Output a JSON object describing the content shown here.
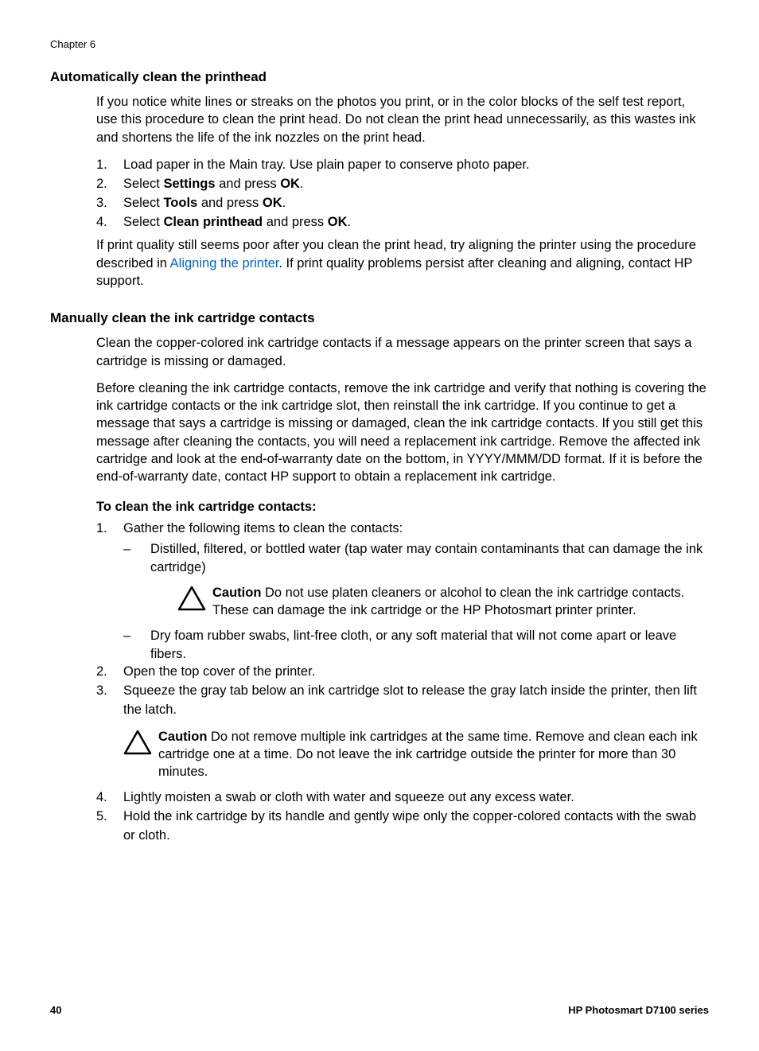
{
  "chapter_label": "Chapter 6",
  "section1": {
    "heading": "Automatically clean the printhead",
    "intro": "If you notice white lines or streaks on the photos you print, or in the color blocks of the self test report, use this procedure to clean the print head. Do not clean the print head unnecessarily, as this wastes ink and shortens the life of the ink nozzles on the print head.",
    "steps": [
      {
        "num": "1.",
        "text_pre": "Load paper in the Main tray. Use plain paper to conserve photo paper."
      },
      {
        "num": "2.",
        "text_pre": "Select ",
        "bold1": "Settings",
        "text_mid": " and press ",
        "bold2": "OK",
        "text_post": "."
      },
      {
        "num": "3.",
        "text_pre": "Select ",
        "bold1": "Tools",
        "text_mid": " and press ",
        "bold2": "OK",
        "text_post": "."
      },
      {
        "num": "4.",
        "text_pre": "Select ",
        "bold1": "Clean printhead",
        "text_mid": " and press ",
        "bold2": "OK",
        "text_post": "."
      }
    ],
    "outro_pre": "If print quality still seems poor after you clean the print head, try aligning the printer using the procedure described in ",
    "outro_link": "Aligning the printer",
    "outro_post": ". If print quality problems persist after cleaning and aligning, contact HP support."
  },
  "section2": {
    "heading": "Manually clean the ink cartridge contacts",
    "para1": "Clean the copper-colored ink cartridge contacts if a message appears on the printer screen that says a cartridge is missing or damaged.",
    "para2": "Before cleaning the ink cartridge contacts, remove the ink cartridge and verify that nothing is covering the ink cartridge contacts or the ink cartridge slot, then reinstall the ink cartridge. If you continue to get a message that says a cartridge is missing or damaged, clean the ink cartridge contacts. If you still get this message after cleaning the contacts, you will need a replacement ink cartridge. Remove the affected ink cartridge and look at the end-of-warranty date on the bottom, in YYYY/MMM/DD format. If it is before the end-of-warranty date, contact HP support to obtain a replacement ink cartridge.",
    "subheading": "To clean the ink cartridge contacts:",
    "step1": {
      "num": "1.",
      "text": "Gather the following items to clean the contacts:"
    },
    "step1_sub1": "Distilled, filtered, or bottled water (tap water may contain contaminants that can damage the ink cartridge)",
    "caution1_label": "Caution",
    "caution1_text": "   Do not use platen cleaners or alcohol to clean the ink cartridge contacts. These can damage the ink cartridge or the HP Photosmart printer printer.",
    "step1_sub2": "Dry foam rubber swabs, lint-free cloth, or any soft material that will not come apart or leave fibers.",
    "step2": {
      "num": "2.",
      "text": "Open the top cover of the printer."
    },
    "step3": {
      "num": "3.",
      "text": "Squeeze the gray tab below an ink cartridge slot to release the gray latch inside the printer, then lift the latch."
    },
    "caution2_label": "Caution",
    "caution2_text": "   Do not remove multiple ink cartridges at the same time. Remove and clean each ink cartridge one at a time. Do not leave the ink cartridge outside the printer for more than 30 minutes.",
    "step4": {
      "num": "4.",
      "text": "Lightly moisten a swab or cloth with water and squeeze out any excess water."
    },
    "step5": {
      "num": "5.",
      "text": "Hold the ink cartridge by its handle and gently wipe only the copper-colored contacts with the swab or cloth."
    }
  },
  "footer": {
    "page": "40",
    "product": "HP Photosmart D7100 series"
  },
  "dash": "–"
}
